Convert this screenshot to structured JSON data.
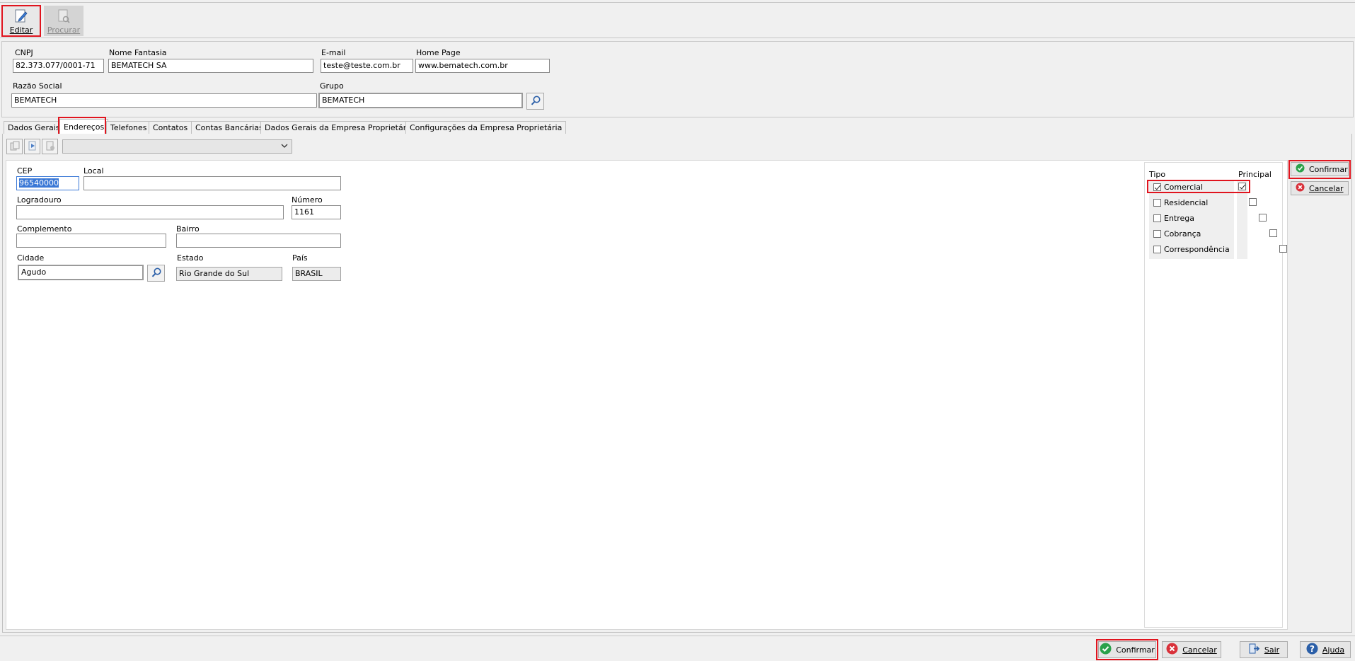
{
  "toolbar": {
    "edit_label": "Editar",
    "search_label": "Procurar"
  },
  "header": {
    "cnpj": {
      "label": "CNPJ",
      "value": "82.373.077/0001-71"
    },
    "nome_fantasia": {
      "label": "Nome Fantasia",
      "value": "BEMATECH SA"
    },
    "email": {
      "label": "E-mail",
      "value": "teste@teste.com.br"
    },
    "home_page": {
      "label": "Home Page",
      "value": "www.bematech.com.br"
    },
    "razao_social": {
      "label": "Razão Social",
      "value": "BEMATECH"
    },
    "grupo": {
      "label": "Grupo",
      "value": "BEMATECH"
    }
  },
  "tabs": [
    {
      "label": "Dados Gerais"
    },
    {
      "label": "Endereços"
    },
    {
      "label": "Telefones"
    },
    {
      "label": "Contatos"
    },
    {
      "label": "Contas Bancárias"
    },
    {
      "label": "Dados Gerais da Empresa Proprietária"
    },
    {
      "label": "Configurações da Empresa Proprietária"
    }
  ],
  "address": {
    "cep": {
      "label": "CEP",
      "value": "96540000"
    },
    "local": {
      "label": "Local",
      "value": ""
    },
    "logradouro": {
      "label": "Logradouro",
      "value": ""
    },
    "numero": {
      "label": "Número",
      "value": "1161"
    },
    "complemento": {
      "label": "Complemento",
      "value": ""
    },
    "bairro": {
      "label": "Bairro",
      "value": ""
    },
    "cidade": {
      "label": "Cidade",
      "value": "Agudo"
    },
    "estado": {
      "label": "Estado",
      "value": "Rio Grande do Sul"
    },
    "pais": {
      "label": "País",
      "value": "BRASIL"
    }
  },
  "type_panel": {
    "col_tipo": "Tipo",
    "col_principal": "Principal",
    "rows": [
      {
        "label": "Comercial",
        "tipo": true,
        "principal": true
      },
      {
        "label": "Residencial",
        "tipo": false,
        "principal": false
      },
      {
        "label": "Entrega",
        "tipo": false,
        "principal": false
      },
      {
        "label": "Cobrança",
        "tipo": false,
        "principal": false
      },
      {
        "label": "Correspondência",
        "tipo": false,
        "principal": false
      }
    ]
  },
  "side_buttons": {
    "confirm": "Confirmar",
    "cancel": "Cancelar"
  },
  "footer": {
    "confirm": "Confirmar",
    "cancel": "Cancelar",
    "exit": "Sair",
    "help": "Ajuda"
  },
  "colors": {
    "highlight": "#e0141e",
    "confirm_green": "#2aa14a",
    "cancel_red": "#d9313a",
    "selection_blue": "#3a78d6",
    "icon_blue": "#2b5fa8"
  }
}
